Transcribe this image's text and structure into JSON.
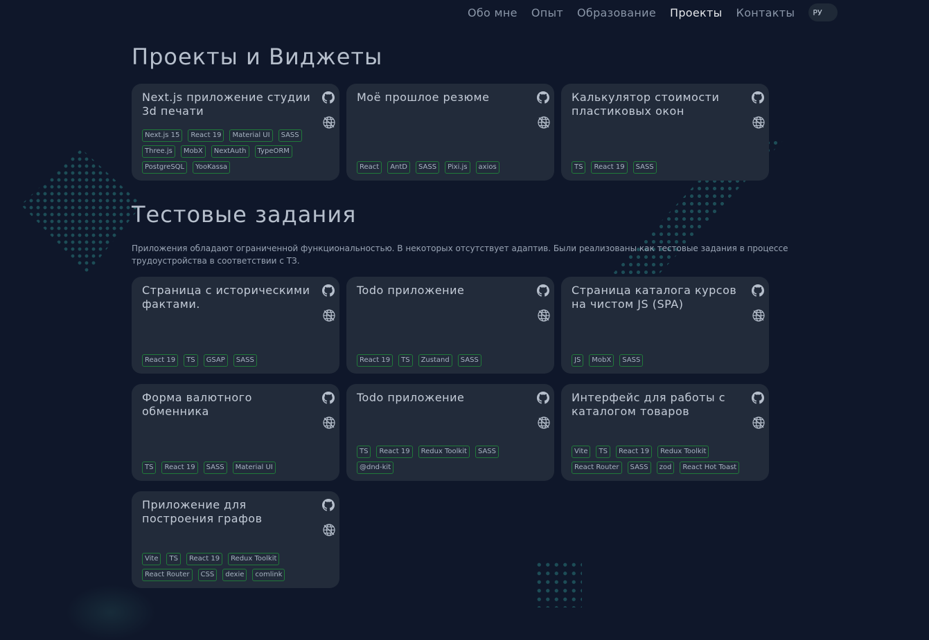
{
  "nav": {
    "items": [
      {
        "label": "Обо мне",
        "active": false
      },
      {
        "label": "Опыт",
        "active": false
      },
      {
        "label": "Образование",
        "active": false
      },
      {
        "label": "Проекты",
        "active": true
      },
      {
        "label": "Контакты",
        "active": false
      }
    ],
    "lang_toggle": "РУ"
  },
  "projects": {
    "title": "Проекты и Виджеты",
    "cards": [
      {
        "title": "Next.js приложение студии 3d печати",
        "tags": [
          "Next.js 15",
          "React 19",
          "Material UI",
          "SASS",
          "Three.js",
          "MobX",
          "NextAuth",
          "TypeORM",
          "PostgreSQL",
          "YooKassa"
        ]
      },
      {
        "title": "Моё прошлое резюме",
        "tags": [
          "React",
          "AntD",
          "SASS",
          "Pixi.js",
          "axios"
        ]
      },
      {
        "title": "Калькулятор стоимости пластиковых окон",
        "tags": [
          "TS",
          "React 19",
          "SASS"
        ]
      }
    ]
  },
  "tests": {
    "title": "Тестовые задания",
    "description": "Приложения обладают ограниченной функциональностью. В некоторых отсутствует адаптив. Были реализованы как тестовые задания в процессе трудоустройства в соответствии с ТЗ.",
    "cards": [
      {
        "title": "Страница с историческими фактами.",
        "tags": [
          "React 19",
          "TS",
          "GSAP",
          "SASS"
        ]
      },
      {
        "title": "Todo приложение",
        "tags": [
          "React 19",
          "TS",
          "Zustand",
          "SASS"
        ]
      },
      {
        "title": "Страница каталога курсов на чистом JS (SPA)",
        "tags": [
          "JS",
          "MobX",
          "SASS"
        ]
      },
      {
        "title": "Форма валютного обменника",
        "tags": [
          "TS",
          "React 19",
          "SASS",
          "Material UI"
        ]
      },
      {
        "title": "Todo приложение",
        "tags": [
          "TS",
          "React 19",
          "Redux Toolkit",
          "SASS",
          "@dnd-kit"
        ]
      },
      {
        "title": "Интерфейс для работы с каталогом товаров",
        "tags": [
          "Vite",
          "TS",
          "React 19",
          "Redux Toolkit",
          "React Router",
          "SASS",
          "zod",
          "React Hot Toast"
        ]
      },
      {
        "title": "Приложение для построения графов",
        "tags": [
          "Vite",
          "TS",
          "React 19",
          "Redux Toolkit",
          "React Router",
          "CSS",
          "dexie",
          "comlink"
        ]
      }
    ]
  },
  "icons": {
    "repo": "github-icon",
    "site": "globe-icon"
  },
  "colors": {
    "background": "#0f172a",
    "card": "#222b3a",
    "tag_border": "#217a3a",
    "dots": "#1d4d57"
  }
}
